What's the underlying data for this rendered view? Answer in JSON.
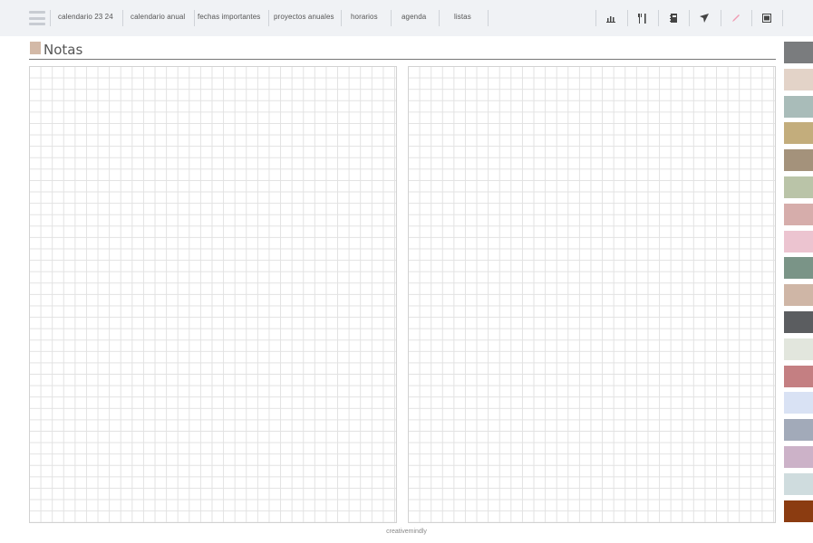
{
  "nav": {
    "items": [
      {
        "label": "calendario 23 24"
      },
      {
        "label": "calendario anual"
      },
      {
        "label": "fechas importantes"
      },
      {
        "label": "proyectos anuales"
      },
      {
        "label": "horarios"
      },
      {
        "label": "agenda"
      },
      {
        "label": "listas"
      }
    ],
    "icons": [
      "bar-chart-icon",
      "utensils-icon",
      "notebook-icon",
      "airplane-icon",
      "pencil-icon",
      "tablet-icon"
    ]
  },
  "page": {
    "title": "Notas",
    "accent_color": "#d3b9a7"
  },
  "color_tabs": [
    "#7a7c7e",
    "#e3d3c8",
    "#a9bcb9",
    "#c3ad7c",
    "#a4927b",
    "#bac4a8",
    "#d6adab",
    "#ecc4d0",
    "#7a9487",
    "#cfb6a6",
    "#5b5d60",
    "#e2e6dd",
    "#c47f82",
    "#d9e2f4",
    "#a2aab9",
    "#ccb2c8",
    "#cfdcde",
    "#8b3c11"
  ],
  "footer": {
    "credit": "creativemindly"
  }
}
